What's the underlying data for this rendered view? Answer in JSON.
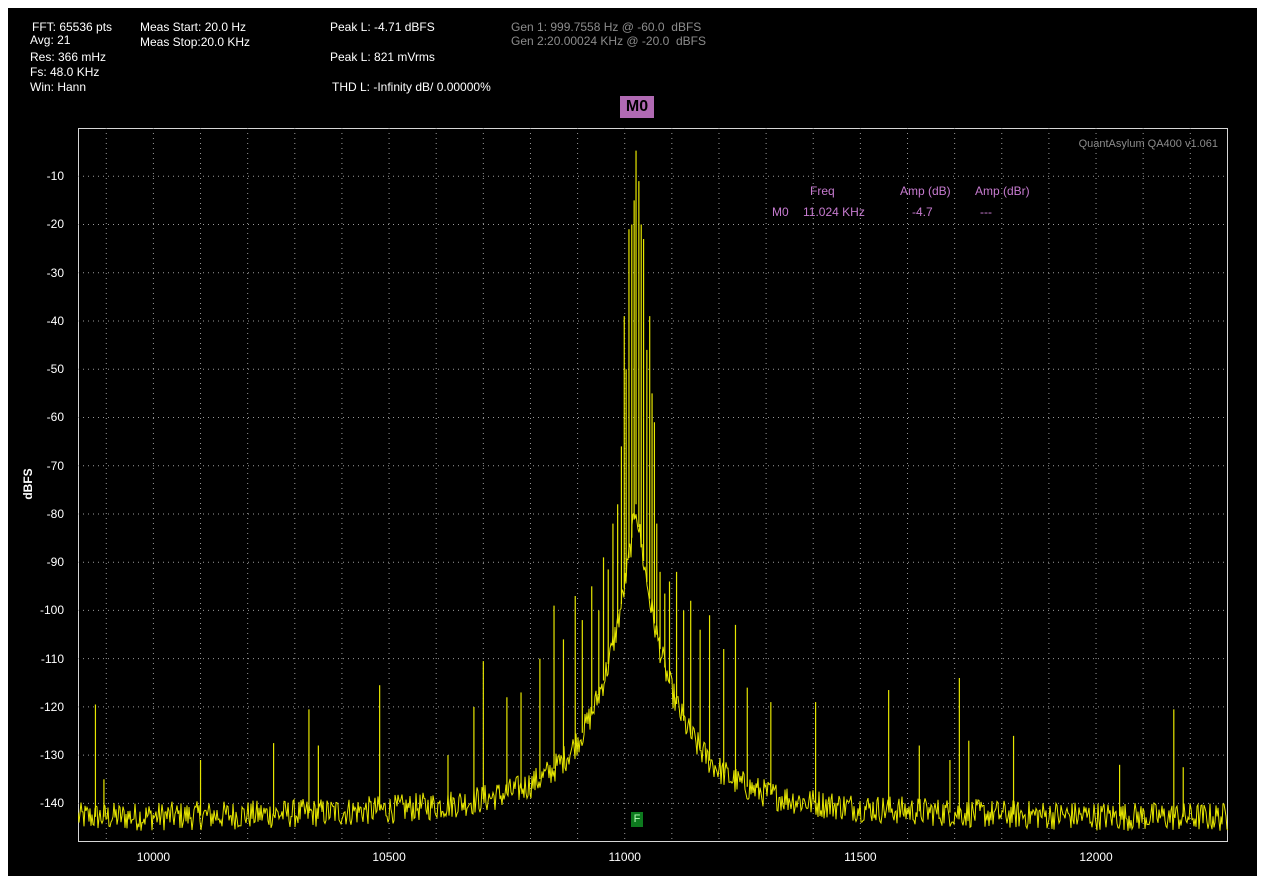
{
  "header": {
    "fft": "FFT: 65536 pts",
    "avg": "Avg: 21",
    "res": "Res: 366 mHz",
    "fs": "Fs: 48.0 KHz",
    "win": "Win: Hann",
    "meas_start": "Meas Start: 20.0 Hz",
    "meas_stop": "Meas Stop:20.0 KHz",
    "peak_dbfs": "Peak L: -4.71 dBFS",
    "peak_vrms": "Peak L: 821 mVrms",
    "thd": "THD L: -Infinity dB/ 0.00000%",
    "gen1": "Gen 1: 999.7558 Hz @ -60.0  dBFS",
    "gen2": "Gen 2:20.00024 KHz @ -20.0  dBFS"
  },
  "marker_flag": "M0",
  "brand": "QuantAsylum QA400 v1.061",
  "marker_table": {
    "col_freq": "Freq",
    "col_amp_db": "Amp (dB)",
    "col_amp_dbr": "Amp (dBr)",
    "row_name": "M0",
    "row_freq": "11.024 KHz",
    "row_amp_db": "-4.7",
    "row_amp_dbr": "---"
  },
  "f_marker": "F",
  "colors": {
    "background": "#000000",
    "trace": "#e6e600",
    "grid": "#9a9a9a",
    "marker": "#c77bd0",
    "marker_flag": "#b06ab3",
    "f_marker": "#0d7a1e"
  },
  "chart_data": {
    "type": "line",
    "title": "",
    "xlabel": "",
    "ylabel": "dBFS",
    "xlim": [
      9840,
      12280
    ],
    "ylim": [
      -148,
      0
    ],
    "x_ticks": [
      10000,
      10500,
      11000,
      11500,
      12000
    ],
    "y_ticks": [
      -10,
      -20,
      -30,
      -40,
      -50,
      -60,
      -70,
      -80,
      -90,
      -100,
      -110,
      -120,
      -130,
      -140
    ],
    "grid": true,
    "noise_floor_db": -143,
    "series": [
      {
        "peaks": [
          {
            "x": 9877,
            "y": -119.5
          },
          {
            "x": 9895,
            "y": -135.0
          },
          {
            "x": 10100,
            "y": -131.0
          },
          {
            "x": 10255,
            "y": -127.5
          },
          {
            "x": 10330,
            "y": -120.5
          },
          {
            "x": 10350,
            "y": -128.0
          },
          {
            "x": 10480,
            "y": -115.5
          },
          {
            "x": 10625,
            "y": -130.0
          },
          {
            "x": 10680,
            "y": -120.0
          },
          {
            "x": 10700,
            "y": -110.5
          },
          {
            "x": 10750,
            "y": -118.0
          },
          {
            "x": 10780,
            "y": -117.0
          },
          {
            "x": 10820,
            "y": -110.0
          },
          {
            "x": 10850,
            "y": -99.0
          },
          {
            "x": 10870,
            "y": -106.0
          },
          {
            "x": 10895,
            "y": -97.0
          },
          {
            "x": 10910,
            "y": -102.0
          },
          {
            "x": 10930,
            "y": -95.0
          },
          {
            "x": 10945,
            "y": -100.0
          },
          {
            "x": 10955,
            "y": -89.0
          },
          {
            "x": 10965,
            "y": -91.5
          },
          {
            "x": 10975,
            "y": -82.0
          },
          {
            "x": 10985,
            "y": -78.0
          },
          {
            "x": 10993,
            "y": -66.0
          },
          {
            "x": 10999,
            "y": -39.0
          },
          {
            "x": 11003,
            "y": -50.0
          },
          {
            "x": 11009,
            "y": -21.0
          },
          {
            "x": 11015,
            "y": -20.0
          },
          {
            "x": 11020,
            "y": -15.0
          },
          {
            "x": 11024,
            "y": -4.7
          },
          {
            "x": 11030,
            "y": -11.0
          },
          {
            "x": 11035,
            "y": -20.0
          },
          {
            "x": 11040,
            "y": -23.0
          },
          {
            "x": 11047,
            "y": -46.0
          },
          {
            "x": 11053,
            "y": -39.0
          },
          {
            "x": 11058,
            "y": -55.0
          },
          {
            "x": 11063,
            "y": -61.0
          },
          {
            "x": 11068,
            "y": -82.0
          },
          {
            "x": 11075,
            "y": -92.0
          },
          {
            "x": 11085,
            "y": -96.5
          },
          {
            "x": 11095,
            "y": -94.0
          },
          {
            "x": 11110,
            "y": -92.0
          },
          {
            "x": 11125,
            "y": -100.0
          },
          {
            "x": 11140,
            "y": -98.0
          },
          {
            "x": 11160,
            "y": -104.0
          },
          {
            "x": 11180,
            "y": -101.0
          },
          {
            "x": 11210,
            "y": -108.0
          },
          {
            "x": 11235,
            "y": -103.0
          },
          {
            "x": 11260,
            "y": -116.0
          },
          {
            "x": 11310,
            "y": -119.0
          },
          {
            "x": 11405,
            "y": -119.0
          },
          {
            "x": 11560,
            "y": -116.5
          },
          {
            "x": 11625,
            "y": -128.0
          },
          {
            "x": 11690,
            "y": -131.0
          },
          {
            "x": 11710,
            "y": -114.0
          },
          {
            "x": 11730,
            "y": -127.0
          },
          {
            "x": 11825,
            "y": -126.0
          },
          {
            "x": 12050,
            "y": -132.0
          },
          {
            "x": 12165,
            "y": -120.5
          },
          {
            "x": 12185,
            "y": -132.5
          }
        ]
      }
    ]
  }
}
